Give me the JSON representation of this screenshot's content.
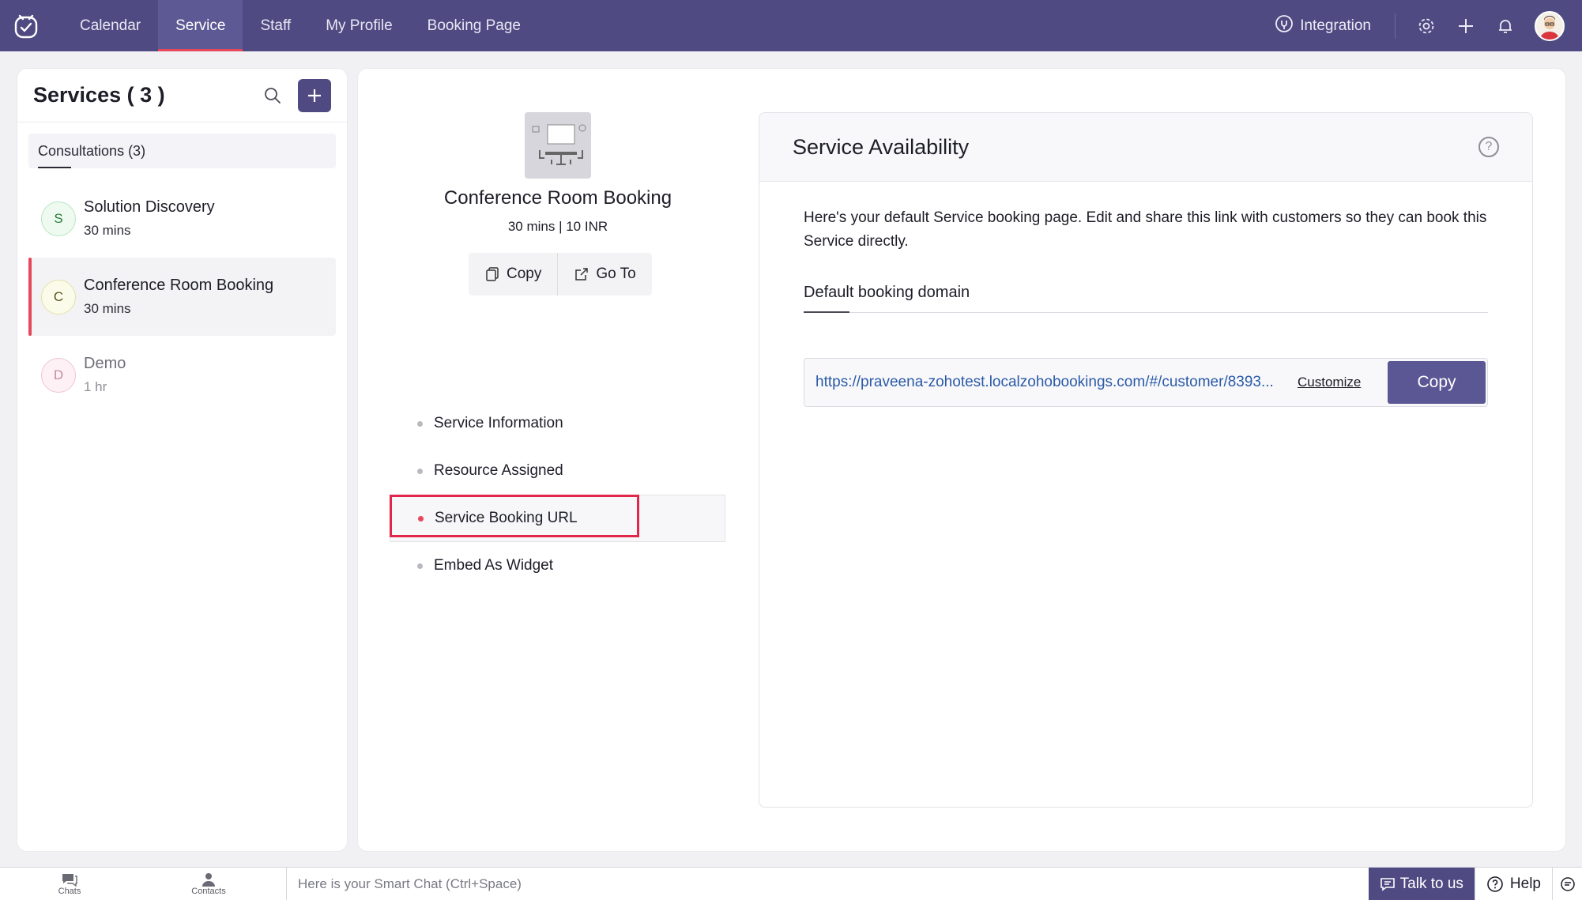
{
  "nav": {
    "items": [
      {
        "label": "Calendar"
      },
      {
        "label": "Service"
      },
      {
        "label": "Staff"
      },
      {
        "label": "My Profile"
      },
      {
        "label": "Booking Page"
      }
    ],
    "integration_label": "Integration"
  },
  "sidebar": {
    "title": "Services ( 3 )",
    "group_tab": "Consultations (3)",
    "services": [
      {
        "initial": "S",
        "name": "Solution Discovery",
        "duration": "30 mins"
      },
      {
        "initial": "C",
        "name": "Conference Room Booking",
        "duration": "30 mins"
      },
      {
        "initial": "D",
        "name": "Demo",
        "duration": "1 hr"
      }
    ]
  },
  "service": {
    "title": "Conference Room Booking",
    "meta": "30 mins | 10 INR",
    "copy_label": "Copy",
    "goto_label": "Go To"
  },
  "menu": {
    "items": [
      {
        "label": "Service Information"
      },
      {
        "label": "Resource Assigned"
      },
      {
        "label": "Service Booking URL"
      },
      {
        "label": "Embed As Widget"
      }
    ]
  },
  "availability": {
    "title": "Service Availability",
    "help": "?",
    "description": "Here's your default Service booking page. Edit and share this link with customers so they can book this Service directly.",
    "domain_label": "Default booking domain",
    "url": "https://praveena-zohotest.localzohobookings.com/#/customer/8393...",
    "customize_label": "Customize",
    "copy_label": "Copy"
  },
  "bottom": {
    "chats_label": "Chats",
    "contacts_label": "Contacts",
    "smartchat_placeholder": "Here is your Smart Chat (Ctrl+Space)",
    "talk_label": "Talk to us",
    "help_label": "Help"
  },
  "colors": {
    "topbar": "#4f4b82",
    "accent_red": "#e6475a",
    "primary_button": "#5b5794",
    "link": "#2a5aa8"
  }
}
